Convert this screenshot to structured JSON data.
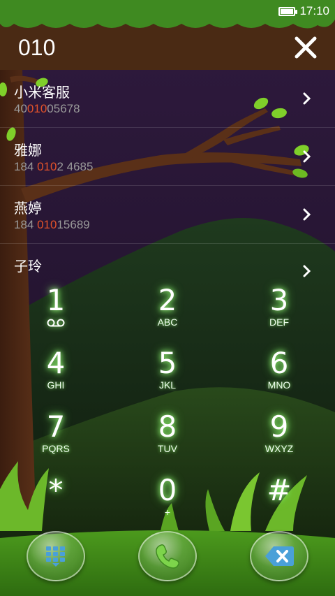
{
  "status_bar": {
    "time": "17:10",
    "battery_level": 1.0
  },
  "header": {
    "dialed_number": "010"
  },
  "contacts": [
    {
      "name": "小米客服",
      "phone_pre": "40",
      "phone_match": "010",
      "phone_post": "05678"
    },
    {
      "name": "雅娜",
      "phone_pre": "184 ",
      "phone_match": "010",
      "phone_post": "2 4685"
    },
    {
      "name": "燕婷",
      "phone_pre": "184 ",
      "phone_match": "010",
      "phone_post": "15689"
    },
    {
      "name": "子玲"
    }
  ],
  "keypad": [
    {
      "digit": "1",
      "letters": ""
    },
    {
      "digit": "2",
      "letters": "ABC"
    },
    {
      "digit": "3",
      "letters": "DEF"
    },
    {
      "digit": "4",
      "letters": "GHI"
    },
    {
      "digit": "5",
      "letters": "JKL"
    },
    {
      "digit": "6",
      "letters": "MNO"
    },
    {
      "digit": "7",
      "letters": "PQRS"
    },
    {
      "digit": "8",
      "letters": "TUV"
    },
    {
      "digit": "9",
      "letters": "WXYZ"
    },
    {
      "digit": "*",
      "letters": ""
    },
    {
      "digit": "0",
      "letters": "+"
    },
    {
      "digit": "#",
      "letters": ""
    }
  ],
  "icons": {
    "close": "close-icon",
    "chevron": "chevron-right-icon",
    "voicemail": "voicemail-icon",
    "keypad_toggle": "keypad-grid-icon",
    "call": "phone-icon",
    "backspace": "backspace-icon"
  },
  "colors": {
    "match_highlight": "#e2522a",
    "key_glow": "#9dff7a",
    "header_brown": "#4a2a14"
  }
}
